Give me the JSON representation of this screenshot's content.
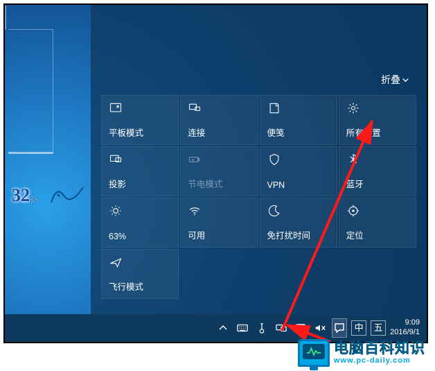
{
  "collapse_label": "折叠",
  "tiles": [
    {
      "key": "tablet",
      "label": "平板模式"
    },
    {
      "key": "connect",
      "label": "连接"
    },
    {
      "key": "note",
      "label": "便笺"
    },
    {
      "key": "settings",
      "label": "所有设置"
    },
    {
      "key": "project",
      "label": "投影"
    },
    {
      "key": "battery",
      "label": "节电模式",
      "disabled": true
    },
    {
      "key": "vpn",
      "label": "VPN"
    },
    {
      "key": "bluetooth",
      "label": "蓝牙"
    },
    {
      "key": "brightness",
      "label": "63%"
    },
    {
      "key": "wifi",
      "label": "可用"
    },
    {
      "key": "quiet",
      "label": "免打扰时间"
    },
    {
      "key": "location",
      "label": "定位"
    },
    {
      "key": "airplane",
      "label": "飞行模式"
    }
  ],
  "tray": {
    "ime_lang": "中",
    "ime_mode": "五"
  },
  "clock": {
    "time": "9:09",
    "date": "2016/9/1"
  },
  "brand": {
    "zh": "电脑百科知识",
    "en": "www.pc-daily.com"
  },
  "logo": {
    "num": "32",
    "suffix": "pc"
  }
}
